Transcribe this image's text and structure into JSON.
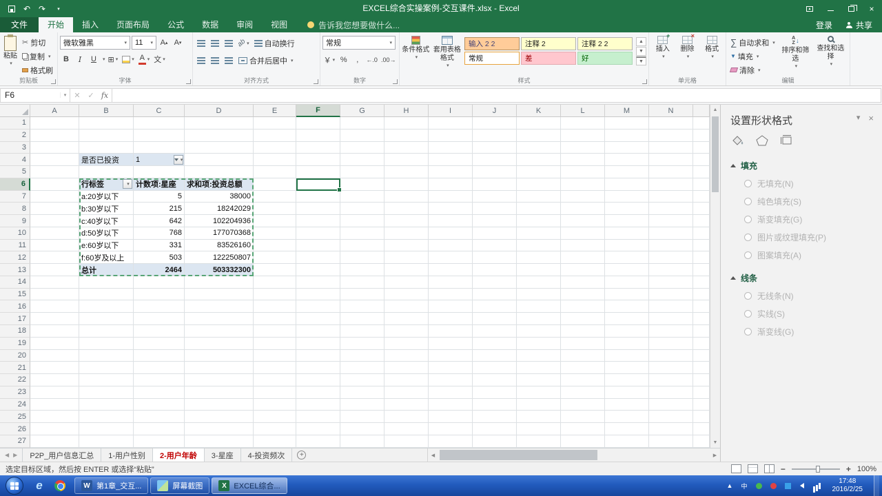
{
  "titlebar": {
    "title": "EXCEL综合实操案例-交互课件.xlsx - Excel",
    "signin": "登录",
    "share": "共享"
  },
  "tabs": {
    "file": "文件",
    "items": [
      "开始",
      "插入",
      "页面布局",
      "公式",
      "数据",
      "审阅",
      "视图"
    ],
    "active": "开始",
    "tellme": "告诉我您想要做什么..."
  },
  "ribbon": {
    "clipboard": {
      "label": "剪贴板",
      "paste": "粘贴",
      "cut": "剪切",
      "copy": "复制",
      "painter": "格式刷"
    },
    "font": {
      "label": "字体",
      "name": "微软雅黑",
      "size": "11",
      "bold": "B",
      "italic": "I",
      "underline": "U",
      "phonetic": "文"
    },
    "alignment": {
      "label": "对齐方式",
      "wrap": "自动换行",
      "merge": "合并后居中",
      "orient": "ab"
    },
    "number": {
      "label": "数字",
      "format": "常规",
      "currency": "￥",
      "percent": "%",
      "comma": ",",
      "inc_decimal": "←.0",
      "dec_decimal": ".00→"
    },
    "styles": {
      "label": "样式",
      "conditional": "条件格式",
      "format_table": "套用表格格式",
      "gallery": [
        {
          "name": "输入 2 2",
          "bg": "#ffcc99",
          "fg": "#3f3f76",
          "border": "#b38f5f",
          "selected": false
        },
        {
          "name": "注释 2",
          "bg": "#ffffcc",
          "fg": "#1a1a1a",
          "border": "#b2b2b2",
          "selected": false
        },
        {
          "name": "注释 2 2",
          "bg": "#ffffcc",
          "fg": "#1a1a1a",
          "border": "#b2b2b2",
          "selected": false
        },
        {
          "name": "常规",
          "bg": "#ffffff",
          "fg": "#1a1a1a",
          "border": "#ababab",
          "selected": true
        },
        {
          "name": "差",
          "bg": "#ffc7ce",
          "fg": "#9c0006",
          "border": "#e3aab1",
          "selected": false
        },
        {
          "name": "好",
          "bg": "#c6efce",
          "fg": "#006100",
          "border": "#a9d8b3",
          "selected": false
        }
      ]
    },
    "cells": {
      "label": "单元格",
      "insert": "插入",
      "delete": "删除",
      "format": "格式"
    },
    "editing": {
      "label": "编辑",
      "sigma": "∑",
      "autosum": "自动求和",
      "fill": "填充",
      "clear": "清除",
      "sort": "排序和筛选",
      "find": "查找和选择",
      "sort_a": "A",
      "sort_z": "Z"
    }
  },
  "formula_bar": {
    "name_box": "F6",
    "fx": "fx",
    "value": ""
  },
  "sheet": {
    "columns": [
      "A",
      "B",
      "C",
      "D",
      "E",
      "F",
      "G",
      "H",
      "I",
      "J",
      "K",
      "L",
      "M",
      "N"
    ],
    "row_count": 27,
    "selected_cell": "F6",
    "filter_label": "是否已投资",
    "filter_value": "1",
    "pivot_headers": [
      "行标签",
      "计数项:星座",
      "求和项:投资总额"
    ],
    "pivot_rows": [
      [
        "a:20岁以下",
        "5",
        "38000"
      ],
      [
        "b:30岁以下",
        "215",
        "18242029"
      ],
      [
        "c:40岁以下",
        "642",
        "102204936"
      ],
      [
        "d:50岁以下",
        "768",
        "177070368"
      ],
      [
        "e:60岁以下",
        "331",
        "83526160"
      ],
      [
        "f:60岁及以上",
        "503",
        "122250807"
      ]
    ],
    "pivot_total": [
      "总计",
      "2464",
      "503332300"
    ]
  },
  "task_pane": {
    "title": "设置形状格式",
    "sections": [
      {
        "title": "填充",
        "options": [
          "无填充(N)",
          "纯色填充(S)",
          "渐变填充(G)",
          "图片或纹理填充(P)",
          "图案填充(A)"
        ]
      },
      {
        "title": "线条",
        "options": [
          "无线条(N)",
          "实线(S)",
          "渐变线(G)"
        ]
      }
    ]
  },
  "sheet_tabs": {
    "tabs": [
      "P2P_用户信息汇总",
      "1-用户性别",
      "2-用户年龄",
      "3-星座",
      "4-投资频次"
    ],
    "active": "2-用户年龄",
    "active_color": "#c00000"
  },
  "status_bar": {
    "message": "选定目标区域，然后按 ENTER 或选择“粘贴”",
    "zoom": "100%"
  },
  "taskbar": {
    "windows": [
      {
        "title": "第1章_交互...",
        "app": "word",
        "icon": "W",
        "active": false
      },
      {
        "title": "屏幕截图",
        "app": "image",
        "icon": "",
        "active": false
      },
      {
        "title": "EXCEL综合...",
        "app": "excel",
        "icon": "X",
        "active": true
      }
    ],
    "ime": "中",
    "ie_glyph": "e",
    "time": "17:48",
    "date": "2016/2/25"
  }
}
